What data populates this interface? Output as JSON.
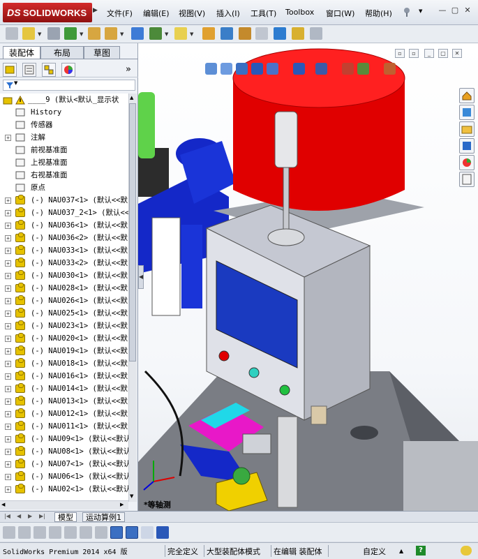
{
  "app": {
    "logo_text": "SOLIDWORKS",
    "logo_prefix": "DS"
  },
  "menu": {
    "items": [
      "文件(F)",
      "编辑(E)",
      "视图(V)",
      "插入(I)",
      "工具(T)",
      "Toolbox",
      "窗口(W)",
      "帮助(H)"
    ]
  },
  "left_panel": {
    "tabs": [
      "装配体",
      "布局",
      "草图"
    ],
    "active_tab": "装配体",
    "collapse_symbol": "»",
    "tree_root": "____9  (默认<默认_显示状",
    "tree_fixed": [
      {
        "label": "History",
        "icon": "history-icon"
      },
      {
        "label": "传感器",
        "icon": "sensor-icon"
      },
      {
        "label": "注解",
        "icon": "annotation-icon",
        "expand": "+"
      },
      {
        "label": "前视基准面",
        "icon": "plane-icon"
      },
      {
        "label": "上视基准面",
        "icon": "plane-icon"
      },
      {
        "label": "右视基准面",
        "icon": "plane-icon"
      },
      {
        "label": "原点",
        "icon": "origin-icon"
      }
    ],
    "tree_components": [
      "(-) NAU037<1> (默认<<默",
      "(-) NAU037_2<1> (默认<<",
      "(-) NAU036<1> (默认<<默",
      "(-) NAU036<2> (默认<<默",
      "(-) NAU033<1> (默认<<默",
      "(-) NAU033<2> (默认<<默",
      "(-) NAU030<1> (默认<<默",
      "(-) NAU028<1> (默认<<默",
      "(-) NAU026<1> (默认<<默",
      "(-) NAU025<1> (默认<<默",
      "(-) NAU023<1> (默认<<默",
      "(-) NAU020<1> (默认<<默",
      "(-) NAU019<1> (默认<<默",
      "(-) NAU018<1> (默认<<默",
      "(-) NAU016<1> (默认<<默",
      "(-) NAU014<1> (默认<<默",
      "(-) NAU013<1> (默认<<默",
      "(-) NAU012<1> (默认<<默",
      "(-) NAU011<1> (默认<<默",
      "(-) NAU09<1> (默认<<默认",
      "(-) NAU08<1> (默认<<默认",
      "(-) NAU07<1> (默认<<默认",
      "(-) NAU06<1> (默认<<默认",
      "(-) NAU02<1> (默认<<默认"
    ]
  },
  "viewport": {
    "triad_label": "*等轴测"
  },
  "bottom_tabs": [
    "模型",
    "运动算例1"
  ],
  "status": {
    "version": "SolidWorks Premium 2014 x64 版",
    "fully_defined": "完全定义",
    "large_assembly": "大型装配体模式",
    "editing": "在编辑 装配体",
    "custom": "自定义",
    "help": "?"
  },
  "colors": {
    "brand_red": "#c41f1f",
    "red_cylinder": "#e00000",
    "blue_parts": "#1428c8",
    "screen_blue": "#1a3ac0",
    "magenta": "#e818c8",
    "cyan": "#20d8e8",
    "green": "#5fd24a",
    "yellow": "#f0d000"
  }
}
